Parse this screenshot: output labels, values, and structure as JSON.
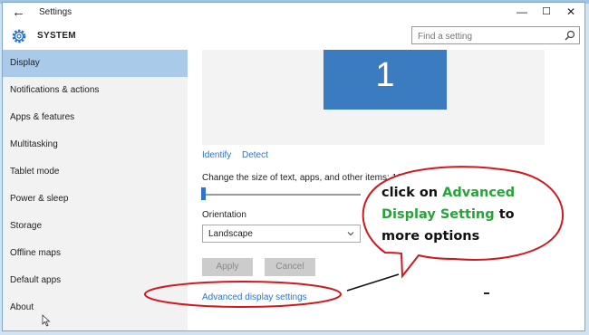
{
  "window": {
    "title": "Settings",
    "controls": {
      "minimize": "—",
      "maximize": "☐",
      "close": "✕"
    }
  },
  "header": {
    "section": "SYSTEM",
    "search_placeholder": "Find a setting"
  },
  "sidebar": {
    "items": [
      {
        "label": "Display",
        "selected": true
      },
      {
        "label": "Notifications & actions",
        "selected": false
      },
      {
        "label": "Apps & features",
        "selected": false
      },
      {
        "label": "Multitasking",
        "selected": false
      },
      {
        "label": "Tablet mode",
        "selected": false
      },
      {
        "label": "Power & sleep",
        "selected": false
      },
      {
        "label": "Storage",
        "selected": false
      },
      {
        "label": "Offline maps",
        "selected": false
      },
      {
        "label": "Default apps",
        "selected": false
      },
      {
        "label": "About",
        "selected": false
      }
    ]
  },
  "display": {
    "monitor_number": "1",
    "identify_link": "Identify",
    "detect_link": "Detect",
    "scale_label": "Change the size of text, apps, and other items: 100% (Recommended)",
    "scale_slider_level": 0,
    "orientation_label": "Orientation",
    "orientation_value": "Landscape",
    "apply_button": "Apply",
    "cancel_button": "Cancel",
    "advanced_link": "Advanced display settings"
  },
  "annotation": {
    "line1_prefix": "click on ",
    "line1_highlight": "Advanced",
    "line2_highlight": "Display Setting",
    "line2_suffix": " to",
    "line3": "more options",
    "highlight_color": "#27a33a",
    "ellipse_color": "#d0191f"
  }
}
